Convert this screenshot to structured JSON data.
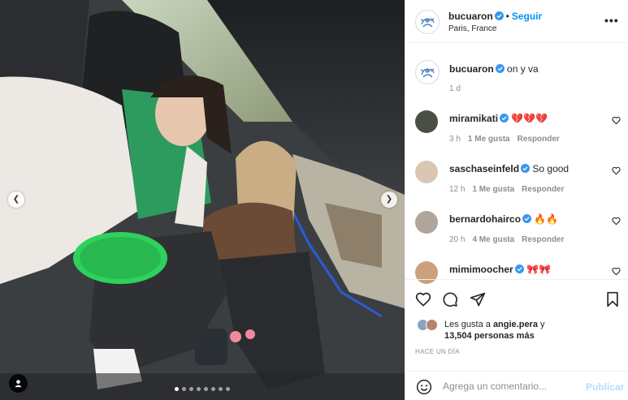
{
  "post": {
    "author": "bucuaron",
    "follow_label": "Seguir",
    "separator": "•",
    "location": "Paris, France",
    "caption": "on y va",
    "caption_age": "1 d",
    "more_label": "•••",
    "carousel_count": 8,
    "carousel_active": 0
  },
  "comments": [
    {
      "user": "miramikati",
      "verified": true,
      "text": "💔💔💔",
      "age": "3 h",
      "likes": "1 Me gusta",
      "reply": "Responder"
    },
    {
      "user": "saschaseinfeld",
      "verified": true,
      "text": "So good",
      "age": "12 h",
      "likes": "1 Me gusta",
      "reply": "Responder"
    },
    {
      "user": "bernardohairco",
      "verified": true,
      "text": "🔥🔥",
      "age": "20 h",
      "likes": "4 Me gusta",
      "reply": "Responder"
    },
    {
      "user": "mimimoocher",
      "verified": true,
      "text": "🎀🎀",
      "age": "",
      "likes": "",
      "reply": ""
    }
  ],
  "likes": {
    "prefix": "Les gusta a",
    "user": "angie.pera",
    "joiner": "y",
    "count_text": "13,504 personas más"
  },
  "timestamp": "HACE UN DÍA",
  "composer": {
    "placeholder": "Agrega un comentario...",
    "publish_label": "Publicar"
  },
  "colors": {
    "accent": "#0095f6",
    "publish_disabled": "#b2dffc",
    "verified": "#3897f0",
    "jacket_green": "#2e9b5e",
    "bag_green": "#2fd15c"
  },
  "icons": [
    "chevron-left-icon",
    "chevron-right-icon",
    "user-tag-icon",
    "heart-icon",
    "comment-icon",
    "share-icon",
    "bookmark-icon",
    "emoji-icon",
    "verified-icon",
    "more-icon"
  ]
}
